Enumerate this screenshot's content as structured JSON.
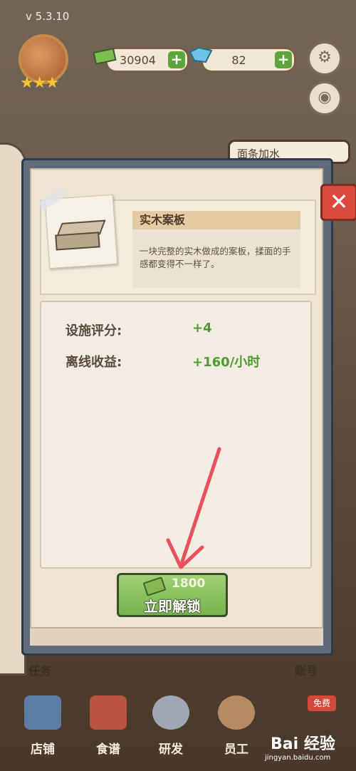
{
  "version": "v 5.3.10",
  "resources": {
    "cash": "30904",
    "gems": "82",
    "plus": "+"
  },
  "top_tag": "面条加水",
  "dialog": {
    "close": "✕",
    "item_name": "实木案板",
    "description": "一块完整的实木做成的案板，揉面的手感都变得不一样了。",
    "stats": [
      {
        "label": "设施评分:",
        "value": "+4"
      },
      {
        "label": "离线收益:",
        "value": "+160/小时"
      }
    ],
    "unlock": {
      "cost": "1800",
      "label": "立即解锁"
    }
  },
  "side_left": "任务",
  "side_right": "账号",
  "nav": [
    {
      "label": "店铺"
    },
    {
      "label": "食谱"
    },
    {
      "label": "研发"
    },
    {
      "label": "员工"
    }
  ],
  "free_badge": "免费",
  "watermark": {
    "brand": "Bai 经验",
    "url": "jingyan.baidu.com"
  },
  "colors": {
    "stat_value": "#4f9a31",
    "unlock_green": "#77b54d",
    "close_red": "#d9493d",
    "arrow": "#e8505b"
  }
}
